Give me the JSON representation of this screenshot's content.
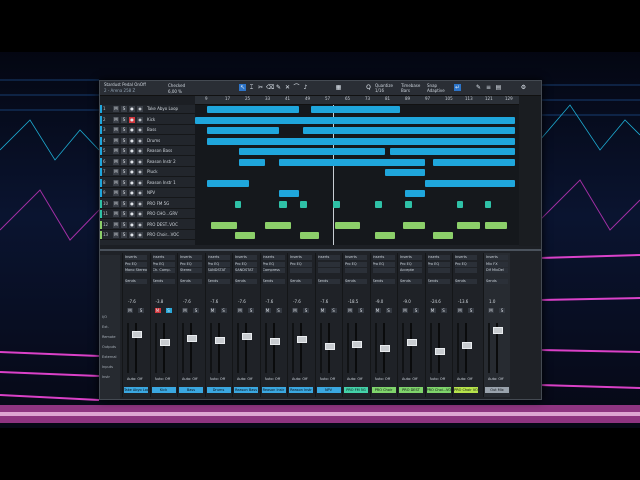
{
  "window": {
    "song_title": "Stardust Pedal OnOff",
    "song_sub": "2 - Arena 258 Z",
    "tempo": "Checked",
    "position": "6,00 %"
  },
  "toolbar": {
    "quantize_label": "Quantize",
    "quantize_value": "1/16",
    "timebase_label": "Timebase",
    "timebase_value": "Bars",
    "snap_label": "Snap",
    "snap_value": "Adaptive"
  },
  "ruler": [
    "9",
    "17",
    "25",
    "33",
    "41",
    "49",
    "57",
    "65",
    "73",
    "81",
    "89",
    "97",
    "105",
    "113",
    "121",
    "129"
  ],
  "tracks": [
    {
      "num": "1",
      "name": "Take Abyo Loop",
      "color": "#1fa6dc",
      "rec": false
    },
    {
      "num": "2",
      "name": "Kick",
      "color": "#1fa6dc",
      "rec": true
    },
    {
      "num": "3",
      "name": "Bass",
      "color": "#1fa6dc",
      "rec": false
    },
    {
      "num": "4",
      "name": "Drums",
      "color": "#1fa6dc",
      "rec": false
    },
    {
      "num": "5",
      "name": "Reason Bass",
      "color": "#1fa6dc",
      "rec": false
    },
    {
      "num": "6",
      "name": "Reason Instr 2",
      "color": "#1fa6dc",
      "rec": false
    },
    {
      "num": "7",
      "name": "Pluck",
      "color": "#1fa6dc",
      "rec": false
    },
    {
      "num": "8",
      "name": "Reason Instr 1",
      "color": "#1fa6dc",
      "rec": false
    },
    {
      "num": "9",
      "name": "NPV",
      "color": "#1fa6dc",
      "rec": false
    },
    {
      "num": "10",
      "name": "PRO FM 5G",
      "color": "#2fc1a7",
      "rec": false
    },
    {
      "num": "11",
      "name": "PRO CHO...GRV",
      "color": "#2fc1a7",
      "rec": false
    },
    {
      "num": "12",
      "name": "PRO DEST..VOC",
      "color": "#8ccf6a",
      "rec": false
    },
    {
      "num": "13",
      "name": "PRO Choir...VOC",
      "color": "#8ccf6a",
      "rec": false
    }
  ],
  "mixer": {
    "nav": [
      "I/O",
      "Ext.",
      "Remote",
      "Outputs",
      "External",
      "Inputs",
      "Instr"
    ],
    "channels": [
      {
        "name": "Take Abyo Loop",
        "vol": "-7.6",
        "insert": "Pro EQ",
        "insert2": "Mono Stereo",
        "color": "#3aa7e0"
      },
      {
        "name": "Kick",
        "vol": "-3.8",
        "insert": "Pro EQ",
        "insert2": "Ch. Comp.",
        "color": "#3aa7e0"
      },
      {
        "name": "Bass",
        "vol": "-7.6",
        "insert": "Pro EQ",
        "insert2": "Stereo",
        "color": "#3aa7e0"
      },
      {
        "name": "Drums",
        "vol": "-7.6",
        "insert": "Pro EQ",
        "insert2": "SANDSTAT",
        "color": "#3aa7e0"
      },
      {
        "name": "Reason Bass",
        "vol": "-7.6",
        "insert": "Pro EQ",
        "insert2": "SANDSTAT",
        "color": "#3aa7e0"
      },
      {
        "name": "Reason Instr",
        "vol": "-7.6",
        "insert": "Pro EQ",
        "insert2": "Compress",
        "color": "#3aa7e0"
      },
      {
        "name": "Reason Instr",
        "vol": "-7.6",
        "insert": "Pro EQ",
        "insert2": "",
        "color": "#3aa7e0"
      },
      {
        "name": "NPV",
        "vol": "-7.6",
        "insert": "",
        "insert2": "",
        "color": "#3aa7e0"
      },
      {
        "name": "PRO FM 5G",
        "vol": "-18.5",
        "insert": "Pro EQ",
        "insert2": "",
        "color": "#44d2a9"
      },
      {
        "name": "PRO Choir",
        "vol": "-9.0",
        "insert": "Pro EQ",
        "insert2": "",
        "color": "#7fd46b"
      },
      {
        "name": "PRO DEST",
        "vol": "-9.0",
        "insert": "Pro EQ",
        "insert2": "Accepte",
        "color": "#7fd46b"
      },
      {
        "name": "PRO Choi...VO",
        "vol": "-24.6",
        "insert": "Pro EQ",
        "insert2": "",
        "color": "#7fd46b"
      },
      {
        "name": "PRO Choir VO",
        "vol": "-13.6",
        "insert": "Pro EQ",
        "insert2": "",
        "color": "#b6e34b"
      },
      {
        "name": "Out Mix",
        "vol": "1.0",
        "insert": "Mix FX",
        "insert2": "Dif MixDel",
        "color": "#9aa3ad"
      }
    ],
    "slot_labels": {
      "inserts": "Inserts",
      "sends": "Sends"
    },
    "mute": "M",
    "solo": "S",
    "auto": "Auto: Off"
  },
  "labels": {
    "mute": "M",
    "solo": "S",
    "rec": "●",
    "monitor": "◉"
  }
}
